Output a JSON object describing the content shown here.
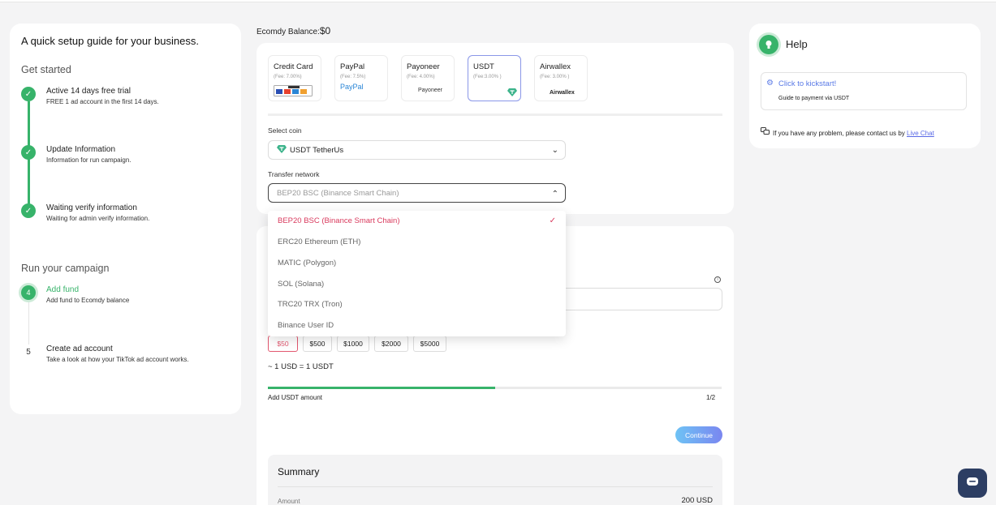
{
  "guide": {
    "title": "A quick setup guide for your business.",
    "get_started": "Get started",
    "run_campaign": "Run your campaign",
    "steps": [
      {
        "title": "Active 14 days free trial",
        "desc": "FREE 1 ad account in the first 14 days."
      },
      {
        "title": "Update Information",
        "desc": "Information for run campaign."
      },
      {
        "title": "Waiting verify information",
        "desc": "Waiting for admin verify information."
      },
      {
        "num": "4",
        "title": "Add fund",
        "desc": "Add fund to Ecomdy balance"
      },
      {
        "num": "5",
        "title": "Create ad account",
        "desc": "Take a look at how your TikTok ad account works."
      }
    ]
  },
  "balance": {
    "label": "Ecomdy Balance:",
    "value": "$0"
  },
  "payment_methods": [
    {
      "name": "Credit Card",
      "fee": "(Fee: 7.00%)",
      "logo": "stripe"
    },
    {
      "name": "PayPal",
      "fee": "(Fee: 7.5%)",
      "logo": "PayPal"
    },
    {
      "name": "Payoneer",
      "fee": "(Fee: 4.00%)",
      "logo": "Payoneer"
    },
    {
      "name": "USDT",
      "fee": "(Fee:3.00% )",
      "logo": ""
    },
    {
      "name": "Airwallex",
      "fee": "(Fee: 3.00% )",
      "logo": "Airwallex"
    }
  ],
  "select_coin": {
    "label": "Select coin",
    "value": "USDT TetherUs"
  },
  "network": {
    "label": "Transfer network",
    "value": "BEP20 BSC (Binance Smart Chain)",
    "options": [
      "BEP20 BSC (Binance Smart Chain)",
      "ERC20 Ethereum (ETH)",
      "MATIC (Polygon)",
      "SOL (Solana)",
      "TRC20 TRX (Tron)",
      "Binance User ID"
    ]
  },
  "amounts": [
    "$50",
    "$500",
    "$1000",
    "$2000",
    "$5000"
  ],
  "rate": "~ 1 USD = 1 USDT",
  "progress": {
    "label": "Add USDT amount",
    "count": "1/2",
    "fraction": 0.5
  },
  "continue_label": "Continue",
  "summary": {
    "title": "Summary",
    "amount_label": "Amount",
    "amount_value": "200 USD"
  },
  "help": {
    "title": "Help",
    "kickstart": "Click to kickstart!",
    "kickstart_desc": "Guide to payment via USDT",
    "contact_text": "If you have any problem, please contact us by",
    "contact_link": "Live Chat"
  },
  "colors": {
    "accent_green": "#37b36a",
    "accent_red": "#d93a5d",
    "link_blue": "#5a7ae6"
  }
}
